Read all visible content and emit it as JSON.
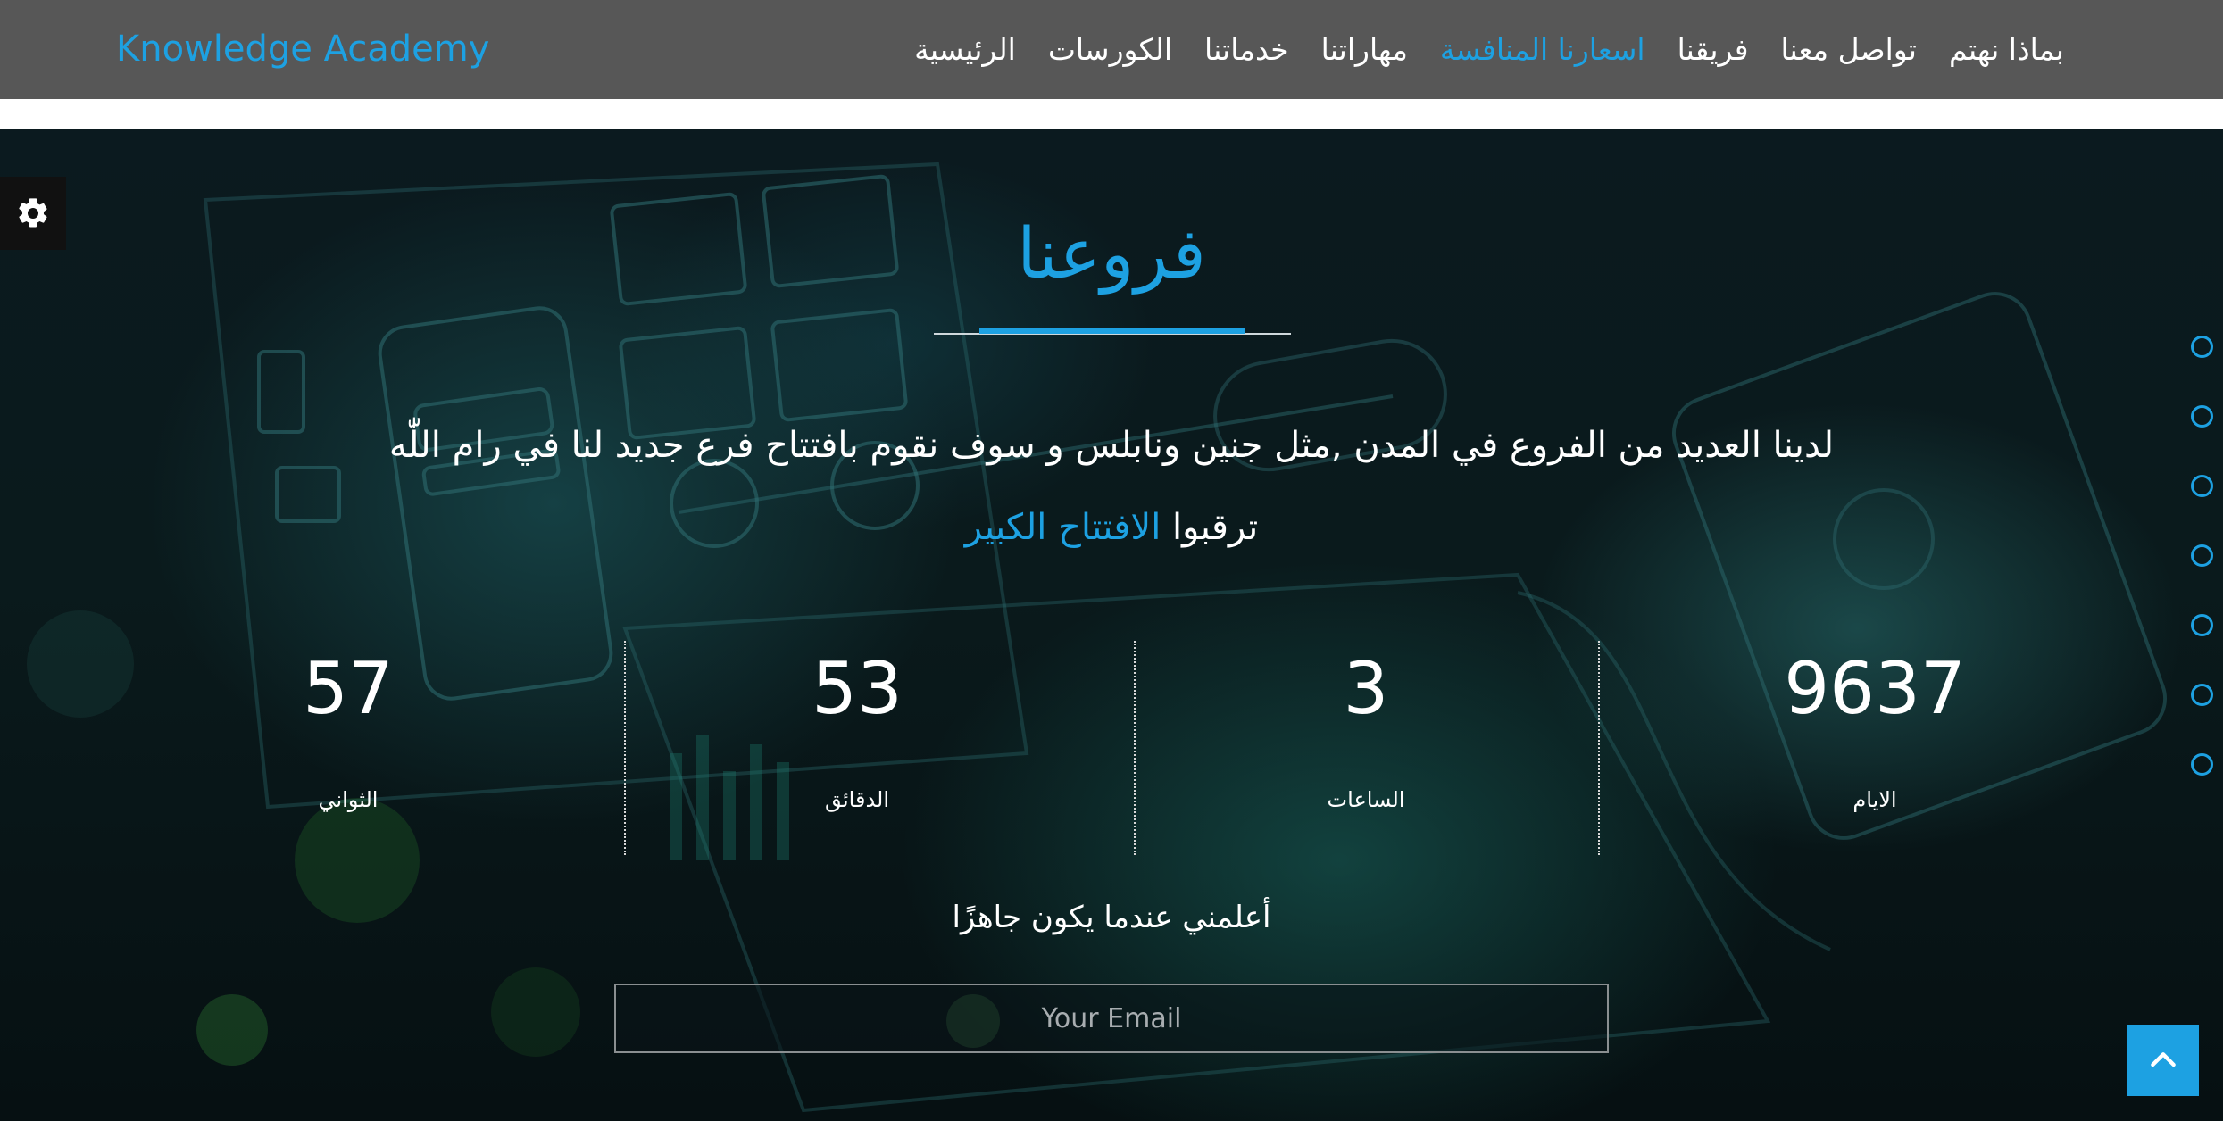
{
  "navbar": {
    "brand": "Knowledge Academy",
    "links": [
      {
        "label": "الرئيسية",
        "active": false
      },
      {
        "label": "الكورسات",
        "active": false
      },
      {
        "label": "خدماتنا",
        "active": false
      },
      {
        "label": "مهاراتنا",
        "active": false
      },
      {
        "label": "اسعارنا المنافسة",
        "active": true
      },
      {
        "label": "فريقنا",
        "active": false
      },
      {
        "label": "تواصل معنا",
        "active": false
      },
      {
        "label": "بماذا نهتم",
        "active": false
      }
    ]
  },
  "hero": {
    "title": "فروعنا",
    "intro": "لدينا العديد من الفروع في المدن ,مثل جنين ونابلس و سوف نقوم بافتتاح فرع جديد لنا في رام اللّٰه",
    "tagline_prefix": "ترقبوا",
    "tagline_highlight": "الافتتاح الكبير",
    "countdown": {
      "days": {
        "value": "9637",
        "label": "الايام"
      },
      "hours": {
        "value": "3",
        "label": "الساعات"
      },
      "minutes": {
        "value": "53",
        "label": "الدقائق"
      },
      "seconds": {
        "value": "57",
        "label": "الثواني"
      }
    },
    "notify_text": "أعلمني عندما يكون جاهزًا",
    "email_placeholder": "Your Email"
  },
  "icons": {
    "settings": "gear-icon",
    "scroll_top": "chevron-up-icon",
    "section_dot": "circle-outline-icon"
  },
  "colors": {
    "accent": "#1da1e2",
    "navbar_bg": "#575757",
    "hero_bg": "#0a1a1c"
  }
}
